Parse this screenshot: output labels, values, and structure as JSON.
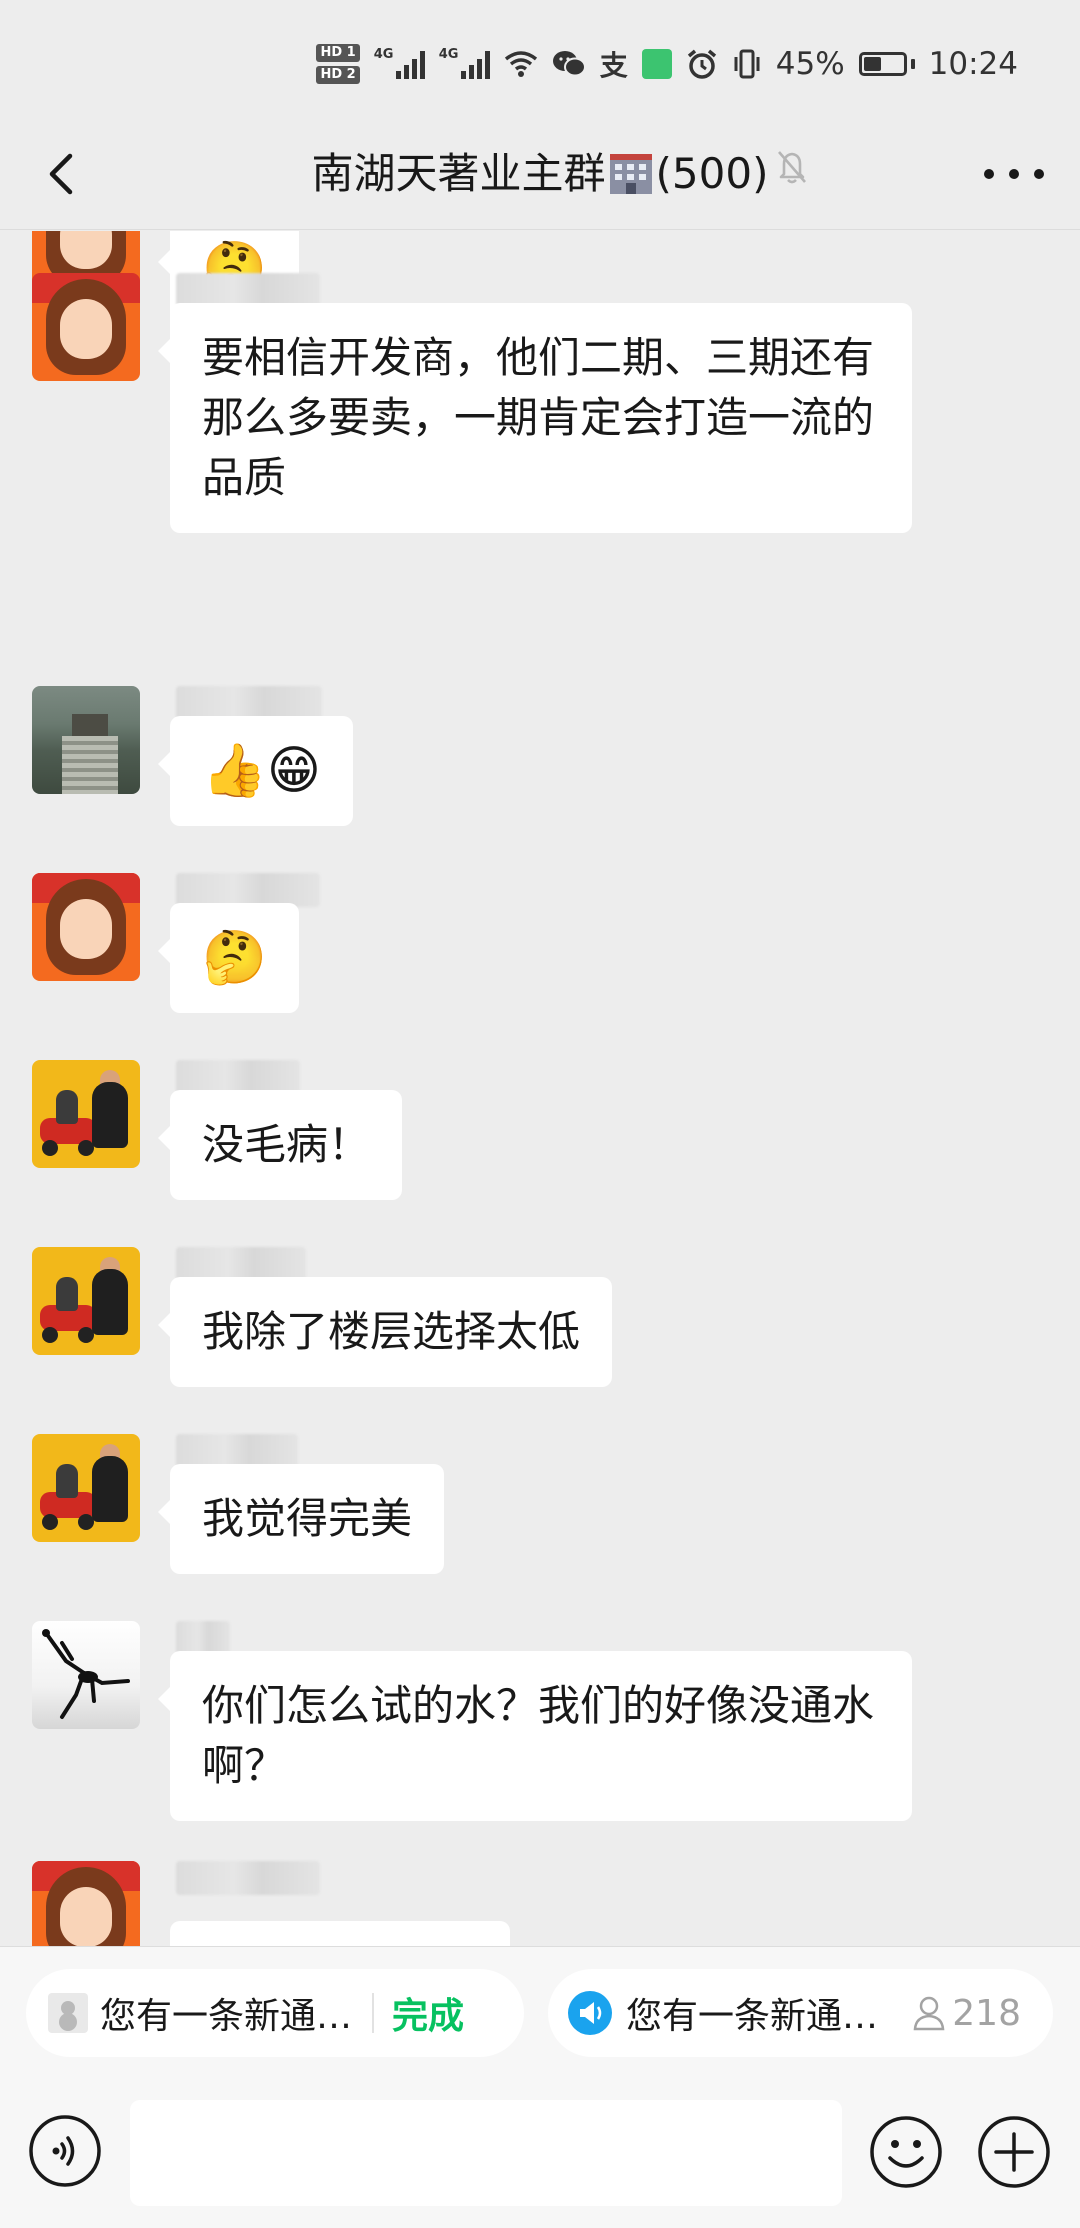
{
  "status_bar": {
    "hd1": "HD 1",
    "hd2": "HD 2",
    "net1": "4G",
    "net2": "4G",
    "alipay": "支",
    "battery_percent": "45%",
    "battery_level": 0.45,
    "time": "10:24"
  },
  "header": {
    "title_prefix": "南湖天著业主群",
    "title_suffix": "(500)",
    "icons": [
      "back-arrow-icon",
      "building-emoji",
      "mute-bell-icon",
      "more-icon"
    ]
  },
  "messages": [
    {
      "avatar": "girl",
      "text": "🤔"
    },
    {
      "avatar": "girl",
      "text": "要相信开发商，他们二期、三期还有那么多要卖，一期肯定会打造一流的品质"
    },
    {
      "avatar": "stairs",
      "text": "👍😁"
    },
    {
      "avatar": "girl",
      "text": "🤔"
    },
    {
      "avatar": "family",
      "text": "没毛病！"
    },
    {
      "avatar": "family",
      "text": "我除了楼层选择太低"
    },
    {
      "avatar": "family",
      "text": "我觉得完美"
    },
    {
      "avatar": "dancer",
      "text": "你们怎么试的水？我们的好像没通水啊？"
    }
  ],
  "notifications": {
    "pill1_text": "您有一条新通…",
    "pill1_action": "完成",
    "pill2_text": "您有一条新通…",
    "pill2_count": "218"
  },
  "input": {
    "icons": [
      "voice-icon",
      "emoji-icon",
      "plus-icon"
    ]
  },
  "colors": {
    "background": "#ededed",
    "bubble": "#ffffff",
    "accent_green": "#07c160",
    "accent_blue": "#1aa3ee"
  }
}
